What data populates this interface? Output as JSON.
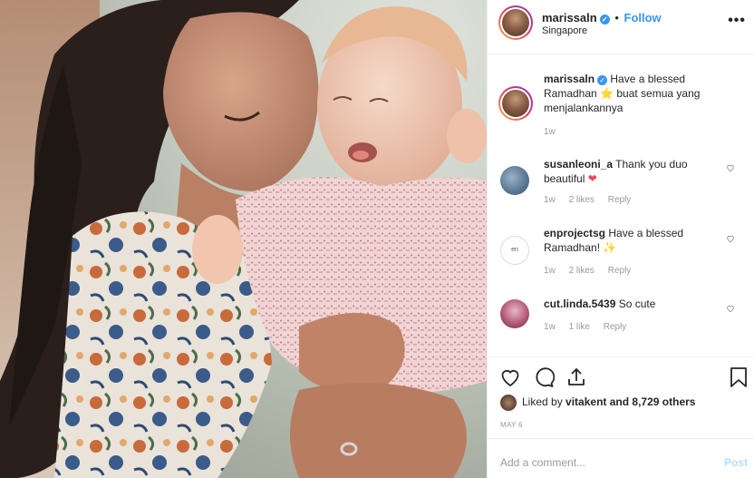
{
  "post": {
    "username": "marissaln",
    "follow": "Follow",
    "dot": "•",
    "location": "Singapore",
    "more": "•••",
    "photo_icon": "mother-kissing-baby-photo"
  },
  "caption": {
    "username": "marissaln",
    "text": "Have a blessed Ramadhan",
    "emoji": "⭐",
    "text2": "buat semua yang menjalankannya",
    "time": "1w"
  },
  "comments": [
    {
      "username": "susanleoni_a",
      "text": "Thank you duo beautiful",
      "emoji": "❤",
      "time": "1w",
      "likes": "2 likes",
      "reply": "Reply"
    },
    {
      "username": "enprojectsg",
      "text": "Have a blessed Ramadhan!",
      "emoji": "✨",
      "time": "1w",
      "likes": "2 likes",
      "reply": "Reply",
      "avatar_text": "en"
    },
    {
      "username": "cut.linda.5439",
      "text": "So cute",
      "time": "1w",
      "likes": "1 like",
      "reply": "Reply"
    }
  ],
  "actions": {
    "liked_by_prefix": "Liked by",
    "liked_by_user": "vitakent",
    "liked_by_suffix": "and 8,729 others",
    "date": "MAY 6"
  },
  "add_comment": {
    "placeholder": "Add a comment...",
    "post": "Post"
  },
  "colors": {
    "accent": "#3897f0",
    "heart": "#ed4956",
    "muted": "#999999"
  }
}
